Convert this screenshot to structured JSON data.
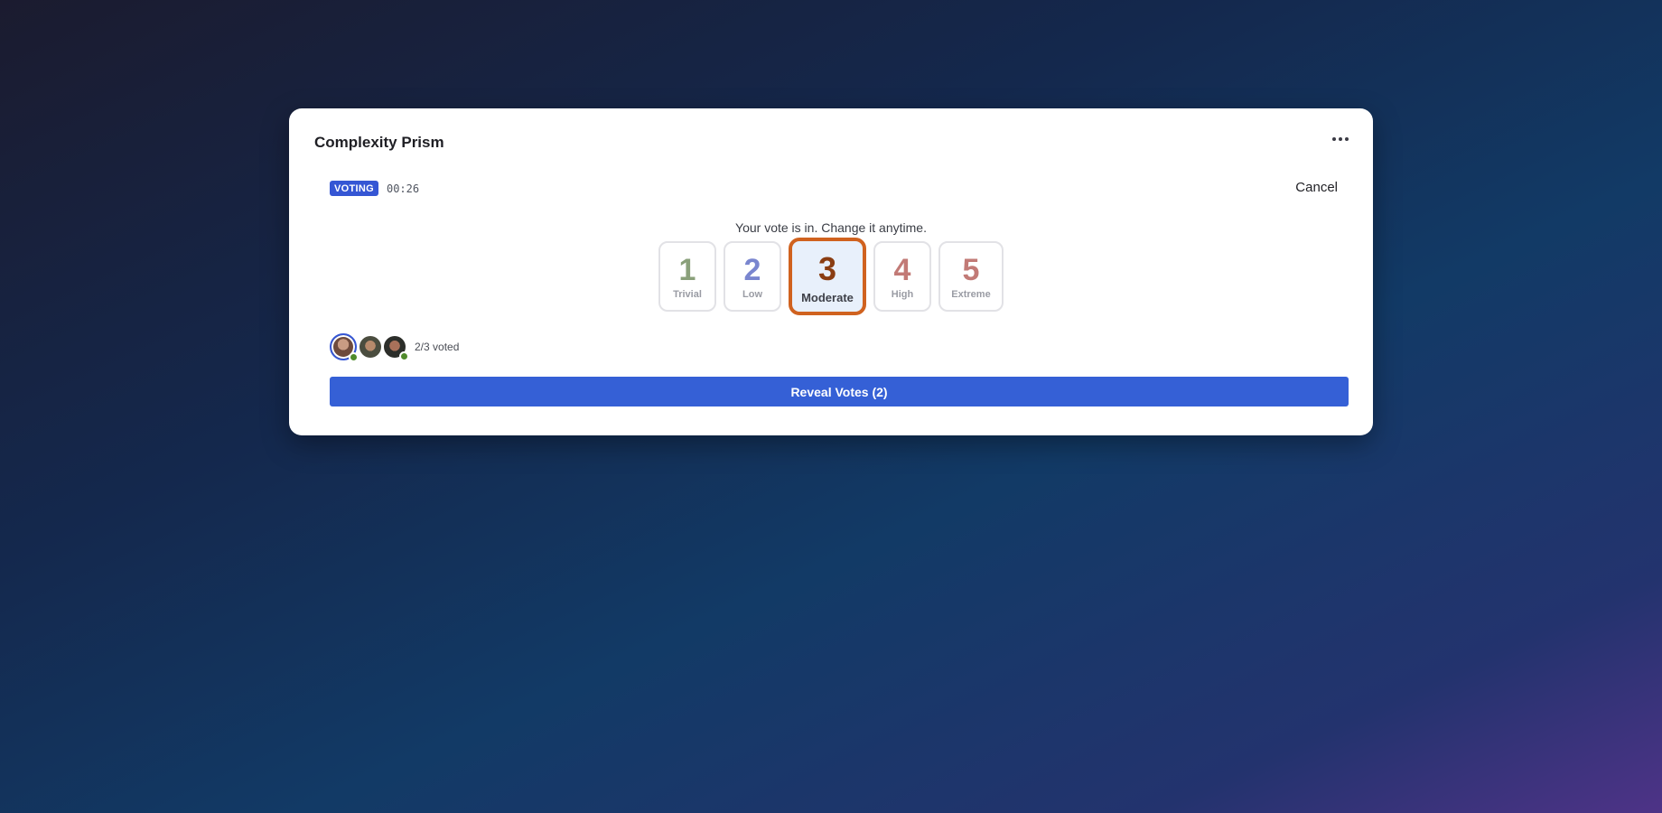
{
  "card": {
    "title": "Complexity Prism"
  },
  "status": {
    "badge": "VOTING",
    "timer": "00:26",
    "cancel_label": "Cancel"
  },
  "vote_message": "Your vote is in. Change it anytime.",
  "options": [
    {
      "number": "1",
      "label": "Trivial",
      "color": "#8aa07a"
    },
    {
      "number": "2",
      "label": "Low",
      "color": "#7a86cf"
    },
    {
      "number": "3",
      "label": "Moderate",
      "color": "#8a3d12",
      "selected": true
    },
    {
      "number": "4",
      "label": "High",
      "color": "#c27a76"
    },
    {
      "number": "5",
      "label": "Extreme",
      "color": "#c27a76"
    }
  ],
  "participants": {
    "voted_text": "2/3 voted",
    "avatars": [
      {
        "name": "avatar",
        "online": true,
        "current_user": true
      },
      {
        "name": "avatar",
        "online": false
      },
      {
        "name": "avatar",
        "online": true
      }
    ]
  },
  "reveal_button": {
    "label": "Reveal Votes (2)",
    "color": "#3560d6"
  },
  "icons": {
    "more": "more-horizontal-icon",
    "online": "online-status-icon"
  }
}
